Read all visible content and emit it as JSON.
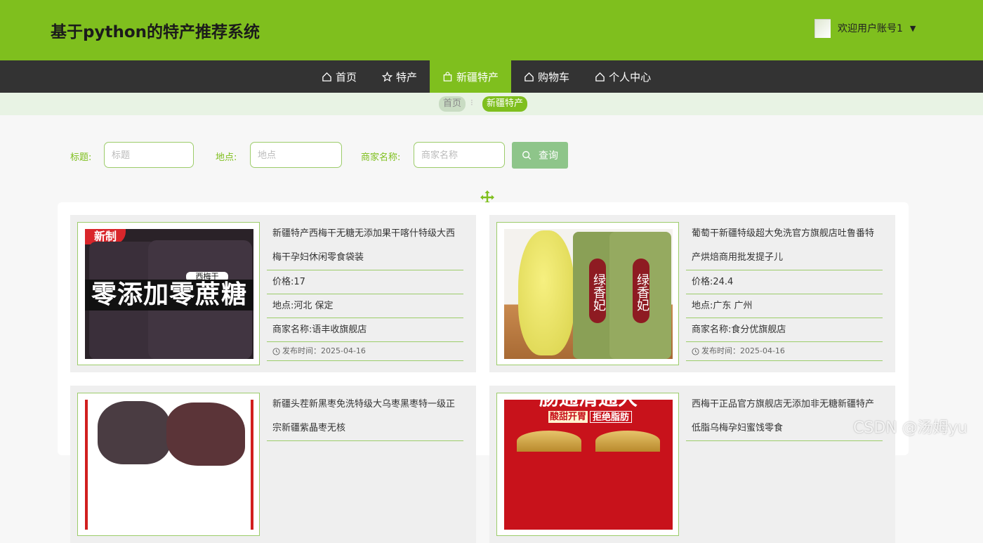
{
  "header": {
    "title": "基于python的特产推荐系统",
    "welcome": "欢迎用户账号1"
  },
  "nav": {
    "items": [
      {
        "label": "首页",
        "icon": "home-icon"
      },
      {
        "label": "特产",
        "icon": "star-icon"
      },
      {
        "label": "新疆特产",
        "icon": "bag-icon",
        "active": true
      },
      {
        "label": "购物车",
        "icon": "home-icon"
      },
      {
        "label": "个人中心",
        "icon": "home-icon"
      }
    ]
  },
  "breadcrumb": {
    "home": "首页",
    "current": "新疆特产"
  },
  "search": {
    "title_label": "标题:",
    "title_placeholder": "标题",
    "location_label": "地点:",
    "location_placeholder": "地点",
    "merchant_label": "商家名称:",
    "merchant_placeholder": "商家名称",
    "query_label": "查询"
  },
  "products": [
    {
      "title": "新疆特产西梅干无糖无添加果干喀什特级大西梅干孕妇休闲零食袋装",
      "price": "价格:17",
      "location": "地点:河北 保定",
      "merchant": "商家名称:语丰收旗舰店",
      "published": "发布时间：2025-04-16",
      "image_text": {
        "badge": "新制",
        "banner": "零添加零蔗糖",
        "jar_label": "西梅干"
      }
    },
    {
      "title": "葡萄干新疆特级超大免洗官方旗舰店吐鲁番特产烘焙商用批发提子儿",
      "price": "价格:24.4",
      "location": "地点:广东 广州",
      "merchant": "商家名称:食分优旗舰店",
      "published": "发布时间：2025-04-16",
      "image_text": {
        "can_label": "绿香妃"
      }
    },
    {
      "title": "新疆头茬新黑枣免洗特级大乌枣黑枣特一级正宗新疆紫晶枣无核",
      "price": "",
      "location": "",
      "merchant": "",
      "published": "",
      "image_text": {}
    },
    {
      "title": "西梅干正品官方旗舰店无添加非无糖新疆特产低脂乌梅孕妇蜜饯零食",
      "price": "",
      "location": "",
      "merchant": "",
      "published": "",
      "image_text": {
        "headline": "肠通清通大",
        "slogan_left": "酸甜开胃",
        "slogan_right": "拒绝脂肪"
      }
    }
  ],
  "watermark": "CSDN @汤姆yu",
  "colors": {
    "brand": "#7fbf1e",
    "nav_bg": "#333333",
    "border": "#9ccc6a",
    "button": "#8ec58a"
  }
}
